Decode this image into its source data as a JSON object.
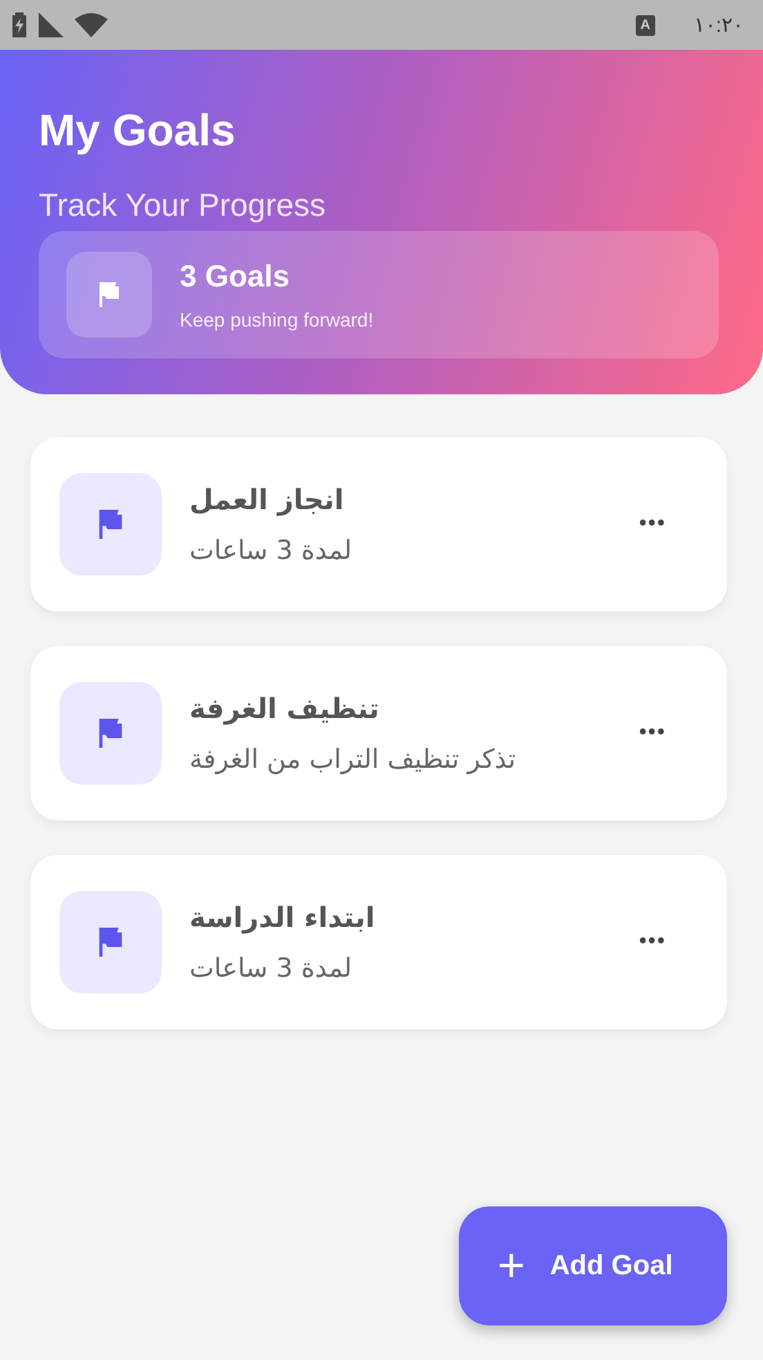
{
  "status_bar": {
    "input_badge": "A",
    "time": "١٠:٢٠"
  },
  "header": {
    "title": "My Goals",
    "subtitle": "Track Your Progress",
    "summary": {
      "count": "3 Goals",
      "message": "Keep pushing forward!"
    }
  },
  "goals": [
    {
      "title": "انجاز العمل",
      "description": "لمدة 3 ساعات",
      "menu": "•••"
    },
    {
      "title": "تنظيف الغرفة",
      "description": "تذكر تنظيف التراب من الغرفة",
      "menu": "•••"
    },
    {
      "title": "ابتداء الدراسة",
      "description": "لمدة 3 ساعات",
      "menu": "•••"
    }
  ],
  "fab": {
    "icon": "+",
    "label": "Add Goal"
  }
}
